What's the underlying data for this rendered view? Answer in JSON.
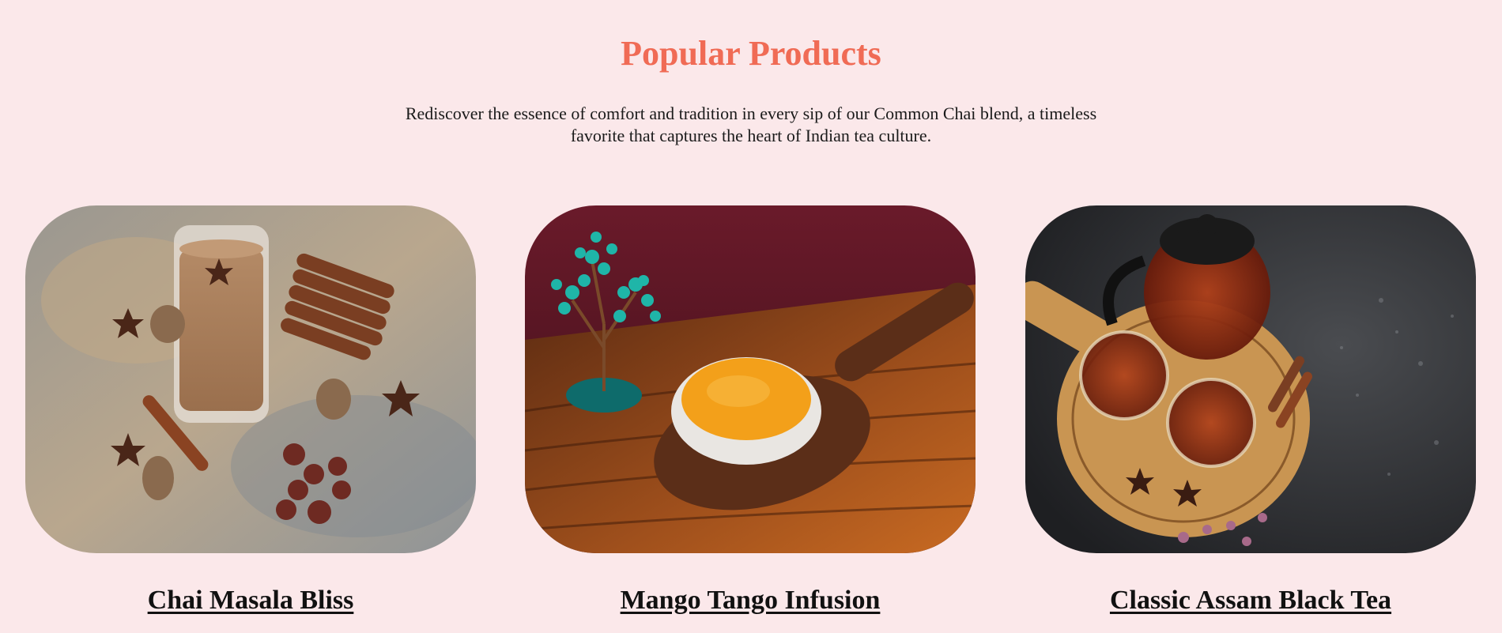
{
  "section": {
    "title": "Popular Products",
    "description": "Rediscover the essence of comfort and tradition in every sip of our Common Chai blend, a timeless favorite that captures the heart of Indian tea culture."
  },
  "products": [
    {
      "title": "Chai Masala Bliss",
      "image": "chai-glass-with-cinnamon-and-star-anise"
    },
    {
      "title": "Mango Tango Infusion",
      "image": "mango-puree-bowl-on-wooden-spoon"
    },
    {
      "title": "Classic Assam Black Tea",
      "image": "teapot-with-cups-on-wooden-tray"
    }
  ],
  "colors": {
    "background": "#fbe8ea",
    "accent": "#f06b55",
    "text": "#111111"
  }
}
